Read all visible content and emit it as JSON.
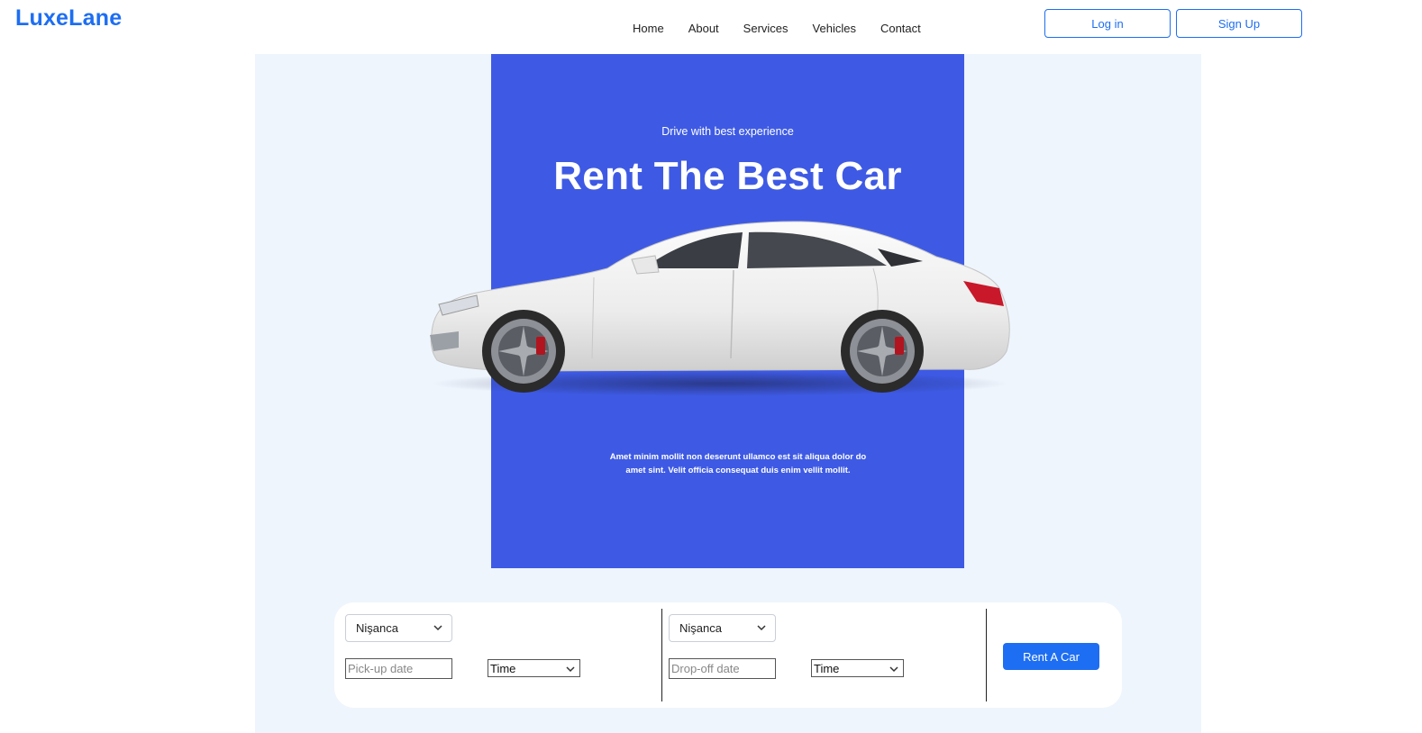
{
  "header": {
    "logo": "LuxeLane",
    "nav": [
      "Home",
      "About",
      "Services",
      "Vehicles",
      "Contact"
    ],
    "login_label": "Log in",
    "signup_label": "Sign Up"
  },
  "hero": {
    "kicker": "Drive with best experience",
    "title": "Rent The Best Car",
    "description": "Amet minim mollit non deserunt ullamco est sit aliqua dolor do amet sint. Velit officia consequat duis enim vellit mollit.",
    "bg_color": "#3e5ae4"
  },
  "booking": {
    "pickup_location": "Nişanca",
    "pickup_date_placeholder": "Pick-up date",
    "pickup_time": "Time",
    "dropoff_location": "Nişanca",
    "dropoff_date_placeholder": "Drop-off date",
    "dropoff_time": "Time",
    "rent_label": "Rent A Car"
  },
  "colors": {
    "brand": "#1d6ef2",
    "page_bg": "#eef5fd"
  }
}
